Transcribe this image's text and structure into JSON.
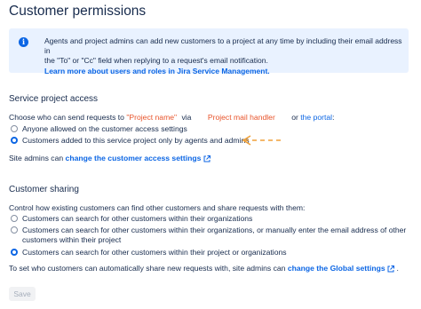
{
  "page": {
    "title": "Customer permissions"
  },
  "info": {
    "line1": "Agents and project admins can add new customers to a project at any time by including their email address in",
    "line2": "the \"To\" or \"Cc\" field when replying to a request's email notification.",
    "link": "Learn more about users and roles in Jira Service Management."
  },
  "access": {
    "heading": "Service project access",
    "prompt_prefix": "Choose who can send requests to",
    "project_name_annotation": "\"Project name\"",
    "via": "via",
    "mail_handler_annotation": "Project mail handler",
    "or_the": "or",
    "portal_link": "the portal",
    "colon": ":",
    "options": [
      {
        "label": "Anyone allowed on the customer access settings",
        "selected": false
      },
      {
        "label": "Customers added to this service project only by agents and admins",
        "selected": true
      }
    ],
    "site_admins_text": "Site admins can",
    "site_admins_link": "change the customer access settings",
    "annotation_color": "#e8542b",
    "arrow_color": "#f0a13a"
  },
  "sharing": {
    "heading": "Customer sharing",
    "prompt": "Control how existing customers can find other customers and share requests with them:",
    "options": [
      {
        "label": "Customers can search for other customers within their organizations",
        "selected": false
      },
      {
        "label_line1": "Customers can search for other customers within their organizations, or manually enter the email address of other",
        "label_line2": "customers within their project",
        "selected": false
      },
      {
        "label": "Customers can search for other customers within their project or organizations",
        "selected": true
      }
    ],
    "global_text": "To set who customers can automatically share new requests with, site admins can",
    "global_link": "change the Global settings"
  },
  "footer": {
    "save_label": "Save"
  },
  "colors": {
    "link": "#0c66e4",
    "info_bg": "#e9f2ff",
    "text": "#172b4d"
  }
}
